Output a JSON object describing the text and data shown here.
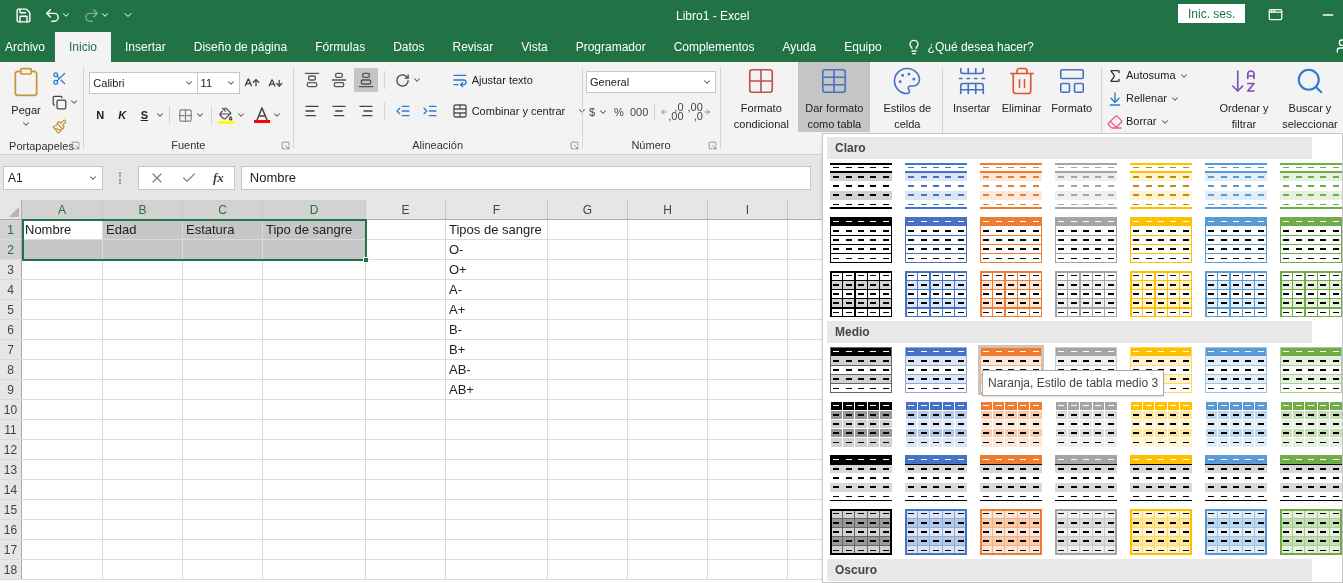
{
  "title_bar": {
    "title": "Libro1  -  Excel",
    "sign_in": "Inic. ses.",
    "quick_access": [
      {
        "kind": "save",
        "disabled": false
      },
      {
        "kind": "undo",
        "disabled": false
      },
      {
        "kind": "redo",
        "disabled": true
      },
      {
        "kind": "customize",
        "disabled": false
      }
    ]
  },
  "tabs": [
    {
      "label": "Archivo",
      "selected": false
    },
    {
      "label": "Inicio",
      "selected": true
    },
    {
      "label": "Insertar",
      "selected": false
    },
    {
      "label": "Diseño de página",
      "selected": false
    },
    {
      "label": "Fórmulas",
      "selected": false
    },
    {
      "label": "Datos",
      "selected": false
    },
    {
      "label": "Revisar",
      "selected": false
    },
    {
      "label": "Vista",
      "selected": false
    },
    {
      "label": "Programador",
      "selected": false
    },
    {
      "label": "Complementos",
      "selected": false
    },
    {
      "label": "Ayuda",
      "selected": false
    },
    {
      "label": "Equipo",
      "selected": false
    }
  ],
  "tell_me": "¿Qué desea hacer?",
  "clipboard": {
    "label": "Portapapeles",
    "paste": "Pegar"
  },
  "font": {
    "label": "Fuente",
    "font_name": "Calibri",
    "font_size": "11",
    "bold": "N",
    "italic": "K",
    "underline": "S"
  },
  "alignment": {
    "label": "Alineación",
    "wrap_text": "Ajustar texto",
    "merge": "Combinar y centrar",
    "vertical": [
      {
        "kind": "top",
        "selected": false
      },
      {
        "kind": "middle",
        "selected": false
      },
      {
        "kind": "bottom",
        "selected": true
      }
    ]
  },
  "number": {
    "label": "Número",
    "format": "General",
    "currency": "$",
    "percent": "%",
    "thousands": "000",
    "decimals": [
      {
        "kind": "increase",
        "top": ",0",
        "bottom": ",00"
      },
      {
        "kind": "decrease",
        "top": ",00",
        "bottom": ",0"
      }
    ]
  },
  "styles": [
    {
      "kind": "conditional",
      "lines": [
        "Formato",
        "condicional"
      ],
      "pressed": false
    },
    {
      "kind": "table",
      "lines": [
        "Dar formato",
        "como tabla"
      ],
      "pressed": true
    },
    {
      "kind": "cell_styles",
      "lines": [
        "Estilos de",
        "celda"
      ],
      "pressed": false
    }
  ],
  "cells": [
    {
      "kind": "insert",
      "lines": [
        "Insertar"
      ],
      "pressed": false
    },
    {
      "kind": "delete",
      "lines": [
        "Eliminar"
      ],
      "pressed": false
    },
    {
      "kind": "format",
      "lines": [
        "Formato"
      ],
      "pressed": false
    }
  ],
  "editing": {
    "small": [
      {
        "kind": "sum",
        "label": "Autosuma"
      },
      {
        "kind": "fill",
        "label": "Rellenar"
      },
      {
        "kind": "clear",
        "label": "Borrar"
      }
    ],
    "large": [
      {
        "kind": "sort",
        "lines": [
          "Ordenar y",
          "filtrar"
        ],
        "pressed": false
      },
      {
        "kind": "find",
        "lines": [
          "Buscar y",
          "seleccionar"
        ],
        "pressed": false
      }
    ]
  },
  "formula_bar": {
    "name_box": "A1",
    "fx": "fx",
    "value": "Nombre"
  },
  "sheet": {
    "columns": [
      {
        "label": "A",
        "selected": true
      },
      {
        "label": "B",
        "selected": true
      },
      {
        "label": "C",
        "selected": true
      },
      {
        "label": "D",
        "selected": true
      },
      {
        "label": "E",
        "selected": false
      },
      {
        "label": "F",
        "selected": false
      },
      {
        "label": "G",
        "selected": false
      },
      {
        "label": "H",
        "selected": false
      },
      {
        "label": "I",
        "selected": false
      }
    ],
    "rows": [
      {
        "label": "1",
        "selected": true,
        "cells": [
          {
            "text": "Nombre",
            "selected": false
          },
          {
            "text": "Edad",
            "selected": true
          },
          {
            "text": "Estatura",
            "selected": true
          },
          {
            "text": "Tipo de sangre",
            "selected": true
          },
          {
            "text": "",
            "selected": false
          },
          {
            "text": "Tipos de sangre",
            "selected": false
          }
        ]
      },
      {
        "label": "2",
        "selected": true,
        "cells": [
          {
            "text": "",
            "selected": true
          },
          {
            "text": "",
            "selected": true
          },
          {
            "text": "",
            "selected": true
          },
          {
            "text": "",
            "selected": true
          },
          {
            "text": "",
            "selected": false
          },
          {
            "text": "O-",
            "selected": false
          }
        ]
      },
      {
        "label": "3",
        "selected": false,
        "cells": [
          "",
          "",
          "",
          "",
          "",
          "O+"
        ]
      },
      {
        "label": "4",
        "selected": false,
        "cells": [
          "",
          "",
          "",
          "",
          "",
          "A-"
        ]
      },
      {
        "label": "5",
        "selected": false,
        "cells": [
          "",
          "",
          "",
          "",
          "",
          "A+"
        ]
      },
      {
        "label": "6",
        "selected": false,
        "cells": [
          "",
          "",
          "",
          "",
          "",
          "B-"
        ]
      },
      {
        "label": "7",
        "selected": false,
        "cells": [
          "",
          "",
          "",
          "",
          "",
          "B+"
        ]
      },
      {
        "label": "8",
        "selected": false,
        "cells": [
          "",
          "",
          "",
          "",
          "",
          "AB-"
        ]
      },
      {
        "label": "9",
        "selected": false,
        "cells": [
          "",
          "",
          "",
          "",
          "",
          "AB+"
        ]
      },
      {
        "label": "10",
        "selected": false
      },
      {
        "label": "11",
        "selected": false
      },
      {
        "label": "12",
        "selected": false
      },
      {
        "label": "13",
        "selected": false
      },
      {
        "label": "14",
        "selected": false
      },
      {
        "label": "15",
        "selected": false
      },
      {
        "label": "16",
        "selected": false
      },
      {
        "label": "17",
        "selected": false
      },
      {
        "label": "18",
        "selected": false
      }
    ]
  },
  "gallery": {
    "tooltip": "Naranja, Estilo de tabla medio 3",
    "sections": [
      {
        "title": "Claro",
        "rows": [
          {
            "kind": "light",
            "styles": [
              {
                "color": "#000000",
                "selected": false
              },
              {
                "color": "#4472c4",
                "selected": false
              },
              {
                "color": "#ed7d31",
                "selected": false
              },
              {
                "color": "#a5a5a5",
                "selected": false
              },
              {
                "color": "#ffc000",
                "selected": false
              },
              {
                "color": "#5b9bd5",
                "selected": false
              },
              {
                "color": "#70ad47",
                "selected": false
              }
            ]
          },
          {
            "kind": "light-header",
            "styles": [
              {
                "color": "#000000",
                "selected": false
              },
              {
                "color": "#4472c4",
                "selected": false
              },
              {
                "color": "#ed7d31",
                "selected": false
              },
              {
                "color": "#a5a5a5",
                "selected": false
              },
              {
                "color": "#ffc000",
                "selected": false
              },
              {
                "color": "#5b9bd5",
                "selected": false
              },
              {
                "color": "#70ad47",
                "selected": false
              }
            ]
          },
          {
            "kind": "light-grid",
            "styles": [
              {
                "color": "#000000",
                "selected": false
              },
              {
                "color": "#4472c4",
                "selected": false
              },
              {
                "color": "#ed7d31",
                "selected": false
              },
              {
                "color": "#a5a5a5",
                "selected": false
              },
              {
                "color": "#ffc000",
                "selected": false
              },
              {
                "color": "#5b9bd5",
                "selected": false
              },
              {
                "color": "#70ad47",
                "selected": false
              }
            ]
          }
        ]
      },
      {
        "title": "Medio",
        "rows": [
          {
            "kind": "medium-banded",
            "styles": [
              {
                "color": "#000000",
                "selected": false
              },
              {
                "color": "#4472c4",
                "selected": false
              },
              {
                "color": "#ed7d31",
                "selected": true
              },
              {
                "color": "#a5a5a5",
                "selected": false
              },
              {
                "color": "#ffc000",
                "selected": false
              },
              {
                "color": "#5b9bd5",
                "selected": false
              },
              {
                "color": "#70ad47",
                "selected": false
              }
            ]
          },
          {
            "kind": "medium-grid",
            "styles": [
              {
                "color": "#000000",
                "selected": false
              },
              {
                "color": "#4472c4",
                "selected": false
              },
              {
                "color": "#ed7d31",
                "selected": false
              },
              {
                "color": "#a5a5a5",
                "selected": false
              },
              {
                "color": "#ffc000",
                "selected": false
              },
              {
                "color": "#5b9bd5",
                "selected": false
              },
              {
                "color": "#70ad47",
                "selected": false
              }
            ]
          },
          {
            "kind": "medium-gray",
            "styles": [
              {
                "color": "#000000",
                "selected": false
              },
              {
                "color": "#4472c4",
                "selected": false
              },
              {
                "color": "#ed7d31",
                "selected": false
              },
              {
                "color": "#a5a5a5",
                "selected": false
              },
              {
                "color": "#ffc000",
                "selected": false
              },
              {
                "color": "#5b9bd5",
                "selected": false
              },
              {
                "color": "#70ad47",
                "selected": false
              }
            ]
          },
          {
            "kind": "medium-tint",
            "styles": [
              {
                "color": "#000000",
                "selected": false
              },
              {
                "color": "#4472c4",
                "selected": false
              },
              {
                "color": "#ed7d31",
                "selected": false
              },
              {
                "color": "#a5a5a5",
                "selected": false
              },
              {
                "color": "#ffc000",
                "selected": false
              },
              {
                "color": "#5b9bd5",
                "selected": false
              },
              {
                "color": "#70ad47",
                "selected": false
              }
            ]
          }
        ]
      },
      {
        "title": "Oscuro"
      }
    ]
  }
}
